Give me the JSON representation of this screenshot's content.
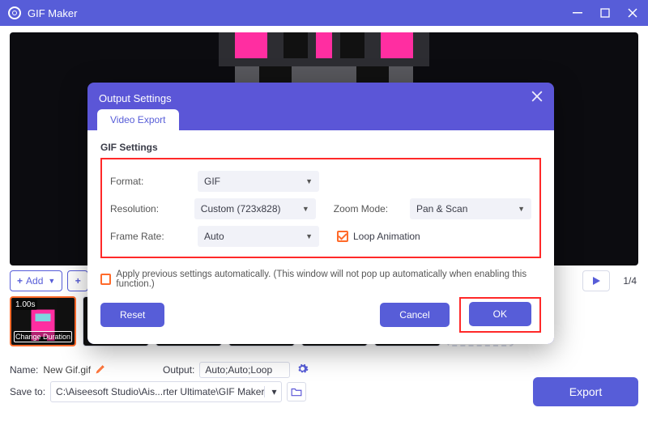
{
  "titlebar": {
    "title": "GIF Maker"
  },
  "controls": {
    "add_label": "Add",
    "pager": "1/4"
  },
  "thumbs": {
    "selected_duration": "1.00s",
    "change_duration_label": "Change Duration"
  },
  "bottom": {
    "name_label": "Name:",
    "name_value": "New Gif.gif",
    "output_label": "Output:",
    "output_value": "Auto;Auto;Loop",
    "saveto_label": "Save to:",
    "saveto_value": "C:\\Aiseesoft Studio\\Ais...rter Ultimate\\GIF Maker",
    "export_label": "Export"
  },
  "modal": {
    "title": "Output Settings",
    "tab_label": "Video Export",
    "section_title": "GIF Settings",
    "format_label": "Format:",
    "format_value": "GIF",
    "resolution_label": "Resolution:",
    "resolution_value": "Custom (723x828)",
    "zoom_label": "Zoom Mode:",
    "zoom_value": "Pan & Scan",
    "framerate_label": "Frame Rate:",
    "framerate_value": "Auto",
    "loop_label": "Loop Animation",
    "apply_label": "Apply previous settings automatically. (This window will not pop up automatically when enabling this function.)",
    "reset_label": "Reset",
    "cancel_label": "Cancel",
    "ok_label": "OK"
  }
}
